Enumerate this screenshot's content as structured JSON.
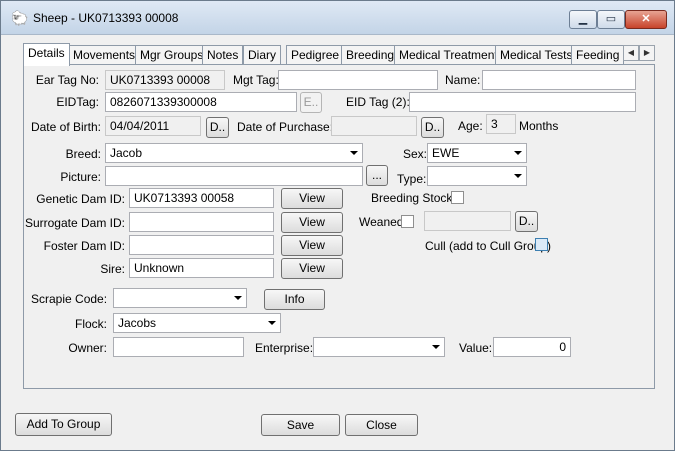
{
  "window": {
    "title": "Sheep - UK0713393 00008",
    "app_icon": "sheep-icon",
    "controls": {
      "minimize": "minimize-icon",
      "maximize": "maximize-icon",
      "close": "close-icon"
    }
  },
  "tabs": [
    {
      "label": "Details",
      "active": true
    },
    {
      "label": "Movements"
    },
    {
      "label": "Mgr Groups"
    },
    {
      "label": "Notes"
    },
    {
      "label": "Diary"
    },
    {
      "label": "Pedigree"
    },
    {
      "label": "Breeding"
    },
    {
      "label": "Medical Treatment"
    },
    {
      "label": "Medical Tests"
    },
    {
      "label": "Feeding"
    }
  ],
  "tab_scroll": {
    "left": "◀",
    "right": "▶"
  },
  "details": {
    "ear_tag_label": "Ear Tag No:",
    "ear_tag_value": "UK0713393 00008",
    "mgt_tag_label": "Mgt Tag:",
    "mgt_tag_value": "",
    "name_label": "Name:",
    "name_value": "",
    "eid_tag_label": "EIDTag:",
    "eid_tag_value": "0826071339300008",
    "eid_button": "E..",
    "eid_tag2_label": "EID Tag (2):",
    "eid_tag2_value": "",
    "dob_label": "Date of Birth:",
    "dob_value": "04/04/2011",
    "dob_button": "D..",
    "dop_label": "Date of Purchase:",
    "dop_value": "",
    "dop_button": "D..",
    "age_label": "Age:",
    "age_value": "3",
    "age_unit": "Months",
    "breed_label": "Breed:",
    "breed_value": "Jacob",
    "sex_label": "Sex:",
    "sex_value": "EWE",
    "picture_label": "Picture:",
    "picture_value": "",
    "picture_button": "...",
    "type_label": "Type:",
    "type_value": "",
    "genetic_dam_label": "Genetic Dam ID:",
    "genetic_dam_value": "UK0713393 00058",
    "surrogate_dam_label": "Surrogate Dam ID:",
    "surrogate_dam_value": "",
    "foster_dam_label": "Foster Dam ID:",
    "foster_dam_value": "",
    "sire_label": "Sire:",
    "sire_value": "Unknown",
    "view_label": "View",
    "breeding_stock_label": "Breeding Stock:",
    "weaned_label": "Weaned",
    "weaned_date_value": "",
    "weaned_button": "D..",
    "cull_label": "Cull (add to Cull Group)",
    "scrapie_label": "Scrapie Code:",
    "scrapie_value": "",
    "info_button": "Info",
    "flock_label": "Flock:",
    "flock_value": "Jacobs",
    "owner_label": "Owner:",
    "owner_value": "",
    "enterprise_label": "Enterprise:",
    "enterprise_value": "",
    "value_label": "Value:",
    "value_value": "0"
  },
  "footer": {
    "add_to_group": "Add To Group",
    "save": "Save",
    "close": "Close"
  }
}
